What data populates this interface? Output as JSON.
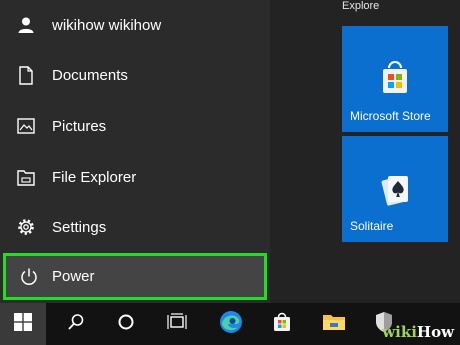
{
  "start_menu": {
    "nav": [
      {
        "label": "wikihow wikihow",
        "icon": "user-icon"
      },
      {
        "label": "Documents",
        "icon": "document-icon"
      },
      {
        "label": "Pictures",
        "icon": "pictures-icon"
      },
      {
        "label": "File Explorer",
        "icon": "file-explorer-icon"
      },
      {
        "label": "Settings",
        "icon": "gear-icon"
      }
    ],
    "power": {
      "label": "Power",
      "icon": "power-icon",
      "highlight_color": "#22dd22"
    },
    "tile_group": {
      "label": "Explore",
      "tiles": [
        {
          "label": "Microsoft Store",
          "icon": "microsoft-store-icon",
          "color": "#0a6fcf"
        },
        {
          "label": "Solitaire",
          "icon": "solitaire-cards-icon",
          "color": "#0a6fcf"
        }
      ]
    }
  },
  "taskbar": {
    "items": [
      "windows-start-icon",
      "search-icon",
      "cortana-icon",
      "task-view-icon",
      "edge-icon",
      "store-icon",
      "file-explorer-icon",
      "security-icon"
    ]
  },
  "watermark": {
    "prefix": "wiki",
    "suffix": "How"
  }
}
